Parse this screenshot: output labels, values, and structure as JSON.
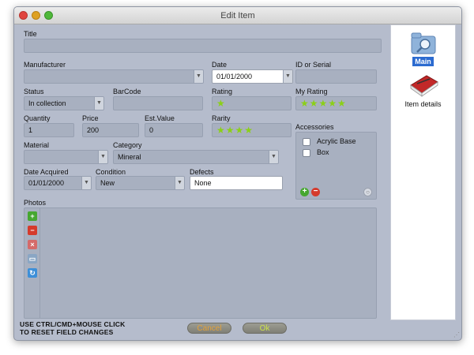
{
  "window": {
    "title": "Edit Item"
  },
  "form": {
    "title_label": "Title",
    "title_value": "",
    "manufacturer_label": "Manufacturer",
    "manufacturer_value": "",
    "date_label": "Date",
    "date_value": "01/01/2000",
    "id_label": "ID or Serial",
    "id_value": "",
    "status_label": "Status",
    "status_value": "In collection",
    "barcode_label": "BarCode",
    "barcode_value": "",
    "rating_label": "Rating",
    "rating_stars": "★",
    "rating_value": 1,
    "my_rating_label": "My Rating",
    "my_rating_stars": "★★★★★",
    "my_rating_value": 5,
    "quantity_label": "Quantity",
    "quantity_value": "1",
    "price_label": "Price",
    "price_value": "200",
    "est_value_label": "Est.Value",
    "est_value_value": "0",
    "rarity_label": "Rarity",
    "rarity_stars": "★★★★",
    "rarity_value": 4,
    "material_label": "Material",
    "material_value": "",
    "category_label": "Category",
    "category_value": "Mineral",
    "accessories_label": "Accessories",
    "accessories": [
      {
        "label": "Acrylic Base",
        "checked": false
      },
      {
        "label": "Box",
        "checked": false
      }
    ],
    "date_acquired_label": "Date Acquired",
    "date_acquired_value": "01/01/2000",
    "condition_label": "Condition",
    "condition_value": "New",
    "defects_label": "Defects",
    "defects_value": "None",
    "photos_label": "Photos"
  },
  "footer": {
    "hint_line1": "USE CTRL/CMD+MOUSE CLICK",
    "hint_line2": "TO RESET FIELD CHANGES",
    "cancel_label": "Cancel",
    "ok_label": "Ok"
  },
  "sidebar": {
    "items": [
      {
        "label": "Main",
        "selected": true
      },
      {
        "label": "Item details",
        "selected": false
      }
    ]
  },
  "colors": {
    "window_bg": "#b5bccc",
    "field_bg": "#a8b0c0",
    "star": "#8bd017",
    "selection": "#2c6bd0",
    "cancel_text": "#e3a13a",
    "ok_text": "#cbe24b"
  }
}
